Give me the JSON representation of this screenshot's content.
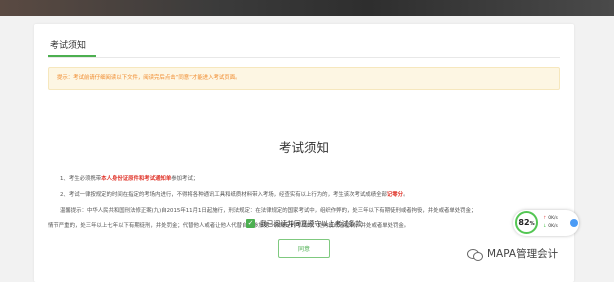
{
  "card": {
    "title": "考试须知",
    "notice": "提示：考试前请仔细阅读以下文件，阅读完后点击“同意”才能进入考试页面。"
  },
  "main": {
    "heading": "考试须知",
    "rules": [
      {
        "parts": [
          {
            "text": "1、考生必须携带",
            "red": false
          },
          {
            "text": "本人身份证原件和考试通知单",
            "red": true
          },
          {
            "text": "参加考试；",
            "red": false
          }
        ]
      },
      {
        "parts": [
          {
            "text": "2、考试一律按规定的时间在指定的考场内进行，不得将各种通讯工具和纸质材料带入考场，经查实有以上行为的，考生该次考试成绩全部",
            "red": false
          },
          {
            "text": "记零分",
            "red": true
          },
          {
            "text": "。",
            "red": false
          }
        ]
      },
      {
        "parts": [
          {
            "text": "温馨提示：中华人民共和国刑法修正案(九)自2015年11月1日起施行，刑法规定：在法律规定的国家考试中，组织作弊的，处三年以下有期徒刑或者拘役，并处或者单处罚金；",
            "red": false
          }
        ]
      },
      {
        "parts": [
          {
            "text": "情节严重的，处三年以上七年以下有期徒刑，并处罚金；代替他人或者让他人代替自己参加第一款规定的考试的，处拘役或者管制，并处或者单处罚金。",
            "red": false
          }
        ]
      }
    ],
    "agree_label": "我已阅读并同意遵守以上考试条款",
    "agree_checked": true,
    "agree_button": "同意"
  },
  "widget": {
    "percent": "82",
    "percent_sign": "%",
    "up_speed": "0K/s",
    "down_speed": "0K/s",
    "up_arrow": "↑",
    "down_arrow": "↓"
  },
  "watermark": {
    "text": "MAPA管理会计",
    "icon": "wechat-icon"
  },
  "colors": {
    "accent": "#4caf50",
    "notice_text": "#f08a2c",
    "notice_bg": "#fdf6e3",
    "warning_red": "#e0362c",
    "widget_ring": "#53c653",
    "widget_ball": "#4b9bf5"
  }
}
